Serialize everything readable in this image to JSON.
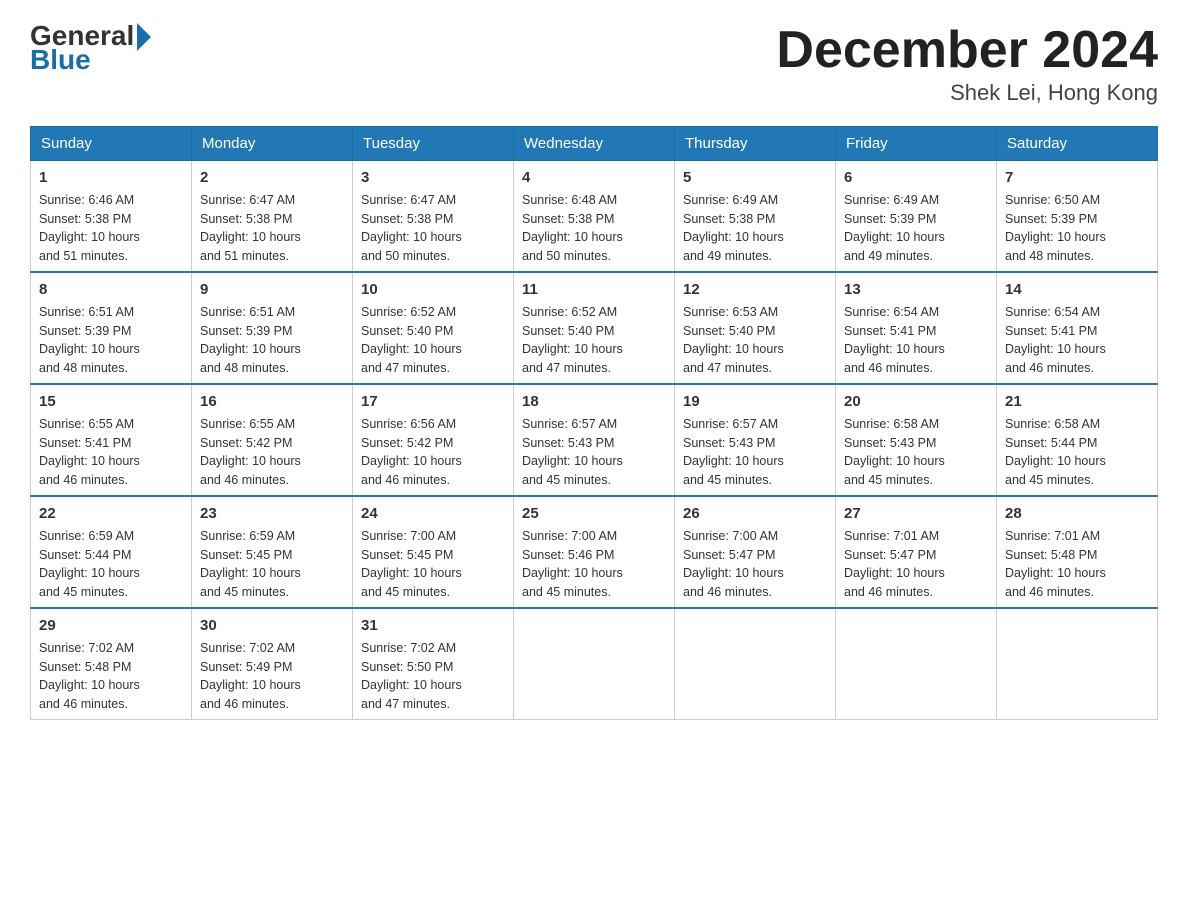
{
  "header": {
    "logo_general": "General",
    "logo_blue": "Blue",
    "month_title": "December 2024",
    "location": "Shek Lei, Hong Kong"
  },
  "days_of_week": [
    "Sunday",
    "Monday",
    "Tuesday",
    "Wednesday",
    "Thursday",
    "Friday",
    "Saturday"
  ],
  "weeks": [
    [
      {
        "num": "1",
        "sunrise": "6:46 AM",
        "sunset": "5:38 PM",
        "daylight": "10 hours and 51 minutes."
      },
      {
        "num": "2",
        "sunrise": "6:47 AM",
        "sunset": "5:38 PM",
        "daylight": "10 hours and 51 minutes."
      },
      {
        "num": "3",
        "sunrise": "6:47 AM",
        "sunset": "5:38 PM",
        "daylight": "10 hours and 50 minutes."
      },
      {
        "num": "4",
        "sunrise": "6:48 AM",
        "sunset": "5:38 PM",
        "daylight": "10 hours and 50 minutes."
      },
      {
        "num": "5",
        "sunrise": "6:49 AM",
        "sunset": "5:38 PM",
        "daylight": "10 hours and 49 minutes."
      },
      {
        "num": "6",
        "sunrise": "6:49 AM",
        "sunset": "5:39 PM",
        "daylight": "10 hours and 49 minutes."
      },
      {
        "num": "7",
        "sunrise": "6:50 AM",
        "sunset": "5:39 PM",
        "daylight": "10 hours and 48 minutes."
      }
    ],
    [
      {
        "num": "8",
        "sunrise": "6:51 AM",
        "sunset": "5:39 PM",
        "daylight": "10 hours and 48 minutes."
      },
      {
        "num": "9",
        "sunrise": "6:51 AM",
        "sunset": "5:39 PM",
        "daylight": "10 hours and 48 minutes."
      },
      {
        "num": "10",
        "sunrise": "6:52 AM",
        "sunset": "5:40 PM",
        "daylight": "10 hours and 47 minutes."
      },
      {
        "num": "11",
        "sunrise": "6:52 AM",
        "sunset": "5:40 PM",
        "daylight": "10 hours and 47 minutes."
      },
      {
        "num": "12",
        "sunrise": "6:53 AM",
        "sunset": "5:40 PM",
        "daylight": "10 hours and 47 minutes."
      },
      {
        "num": "13",
        "sunrise": "6:54 AM",
        "sunset": "5:41 PM",
        "daylight": "10 hours and 46 minutes."
      },
      {
        "num": "14",
        "sunrise": "6:54 AM",
        "sunset": "5:41 PM",
        "daylight": "10 hours and 46 minutes."
      }
    ],
    [
      {
        "num": "15",
        "sunrise": "6:55 AM",
        "sunset": "5:41 PM",
        "daylight": "10 hours and 46 minutes."
      },
      {
        "num": "16",
        "sunrise": "6:55 AM",
        "sunset": "5:42 PM",
        "daylight": "10 hours and 46 minutes."
      },
      {
        "num": "17",
        "sunrise": "6:56 AM",
        "sunset": "5:42 PM",
        "daylight": "10 hours and 46 minutes."
      },
      {
        "num": "18",
        "sunrise": "6:57 AM",
        "sunset": "5:43 PM",
        "daylight": "10 hours and 45 minutes."
      },
      {
        "num": "19",
        "sunrise": "6:57 AM",
        "sunset": "5:43 PM",
        "daylight": "10 hours and 45 minutes."
      },
      {
        "num": "20",
        "sunrise": "6:58 AM",
        "sunset": "5:43 PM",
        "daylight": "10 hours and 45 minutes."
      },
      {
        "num": "21",
        "sunrise": "6:58 AM",
        "sunset": "5:44 PM",
        "daylight": "10 hours and 45 minutes."
      }
    ],
    [
      {
        "num": "22",
        "sunrise": "6:59 AM",
        "sunset": "5:44 PM",
        "daylight": "10 hours and 45 minutes."
      },
      {
        "num": "23",
        "sunrise": "6:59 AM",
        "sunset": "5:45 PM",
        "daylight": "10 hours and 45 minutes."
      },
      {
        "num": "24",
        "sunrise": "7:00 AM",
        "sunset": "5:45 PM",
        "daylight": "10 hours and 45 minutes."
      },
      {
        "num": "25",
        "sunrise": "7:00 AM",
        "sunset": "5:46 PM",
        "daylight": "10 hours and 45 minutes."
      },
      {
        "num": "26",
        "sunrise": "7:00 AM",
        "sunset": "5:47 PM",
        "daylight": "10 hours and 46 minutes."
      },
      {
        "num": "27",
        "sunrise": "7:01 AM",
        "sunset": "5:47 PM",
        "daylight": "10 hours and 46 minutes."
      },
      {
        "num": "28",
        "sunrise": "7:01 AM",
        "sunset": "5:48 PM",
        "daylight": "10 hours and 46 minutes."
      }
    ],
    [
      {
        "num": "29",
        "sunrise": "7:02 AM",
        "sunset": "5:48 PM",
        "daylight": "10 hours and 46 minutes."
      },
      {
        "num": "30",
        "sunrise": "7:02 AM",
        "sunset": "5:49 PM",
        "daylight": "10 hours and 46 minutes."
      },
      {
        "num": "31",
        "sunrise": "7:02 AM",
        "sunset": "5:50 PM",
        "daylight": "10 hours and 47 minutes."
      },
      null,
      null,
      null,
      null
    ]
  ],
  "labels": {
    "sunrise": "Sunrise:",
    "sunset": "Sunset:",
    "daylight": "Daylight:"
  }
}
